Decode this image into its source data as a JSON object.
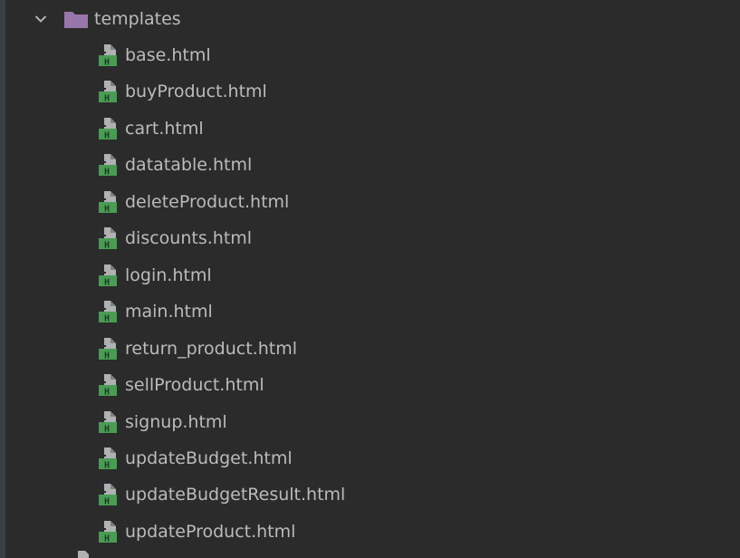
{
  "folder": {
    "name": "templates",
    "expanded": true,
    "icon": "folder-icon",
    "icon_color": "#9876aa"
  },
  "files": [
    {
      "name": "base.html",
      "icon": "html-file-icon"
    },
    {
      "name": "buyProduct.html",
      "icon": "html-file-icon"
    },
    {
      "name": "cart.html",
      "icon": "html-file-icon"
    },
    {
      "name": "datatable.html",
      "icon": "html-file-icon"
    },
    {
      "name": "deleteProduct.html",
      "icon": "html-file-icon"
    },
    {
      "name": "discounts.html",
      "icon": "html-file-icon"
    },
    {
      "name": "login.html",
      "icon": "html-file-icon"
    },
    {
      "name": "main.html",
      "icon": "html-file-icon"
    },
    {
      "name": "return_product.html",
      "icon": "html-file-icon"
    },
    {
      "name": "sellProduct.html",
      "icon": "html-file-icon"
    },
    {
      "name": "signup.html",
      "icon": "html-file-icon"
    },
    {
      "name": "updateBudget.html",
      "icon": "html-file-icon"
    },
    {
      "name": "updateBudgetResult.html",
      "icon": "html-file-icon"
    },
    {
      "name": "updateProduct.html",
      "icon": "html-file-icon"
    }
  ],
  "colors": {
    "background": "#2b2b2b",
    "text": "#bbbbbb",
    "html_icon_green": "#499c54",
    "html_icon_gray": "#afb1b3"
  }
}
